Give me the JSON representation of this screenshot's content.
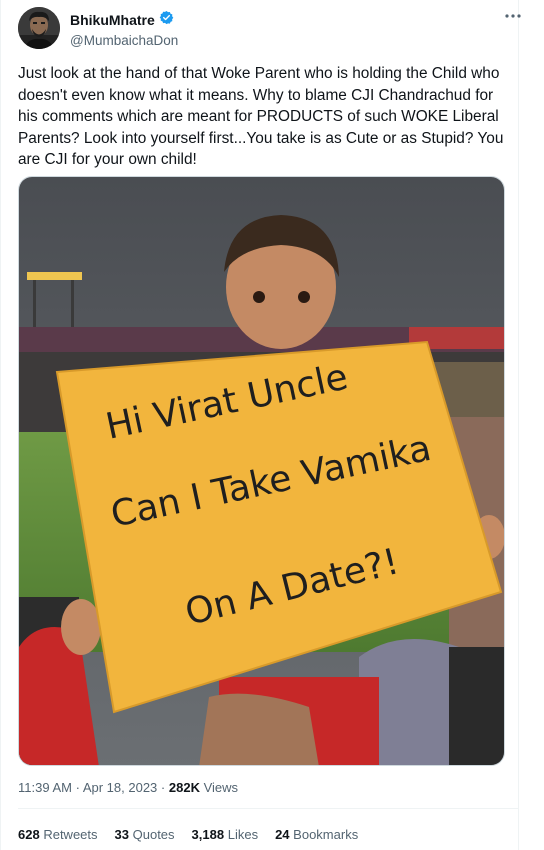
{
  "author": {
    "name": "BhikuMhatre",
    "handle": "@MumbaichaDon",
    "verified": true,
    "badge_color": "#1d9bf0"
  },
  "more_icon": "more-horizontal-icon",
  "tweet_text": "Just look at the hand of that Woke Parent who is holding the Child who doesn't even know what it means. Why to blame CJI Chandrachud for his comments which are meant for PRODUCTS of such WOKE Liberal Parents? Look into yourself first...You take is as Cute or as Stupid? You are CJI for your own child!",
  "photo": {
    "sign_lines": [
      "Hi Virat Uncle",
      "Can I Take Vamika",
      "On A Date?!"
    ]
  },
  "meta": {
    "time": "11:39 AM",
    "separator": "·",
    "date": "Apr 18, 2023",
    "views_count": "282K",
    "views_label": "Views"
  },
  "stats": {
    "retweets_count": "628",
    "retweets_label": "Retweets",
    "quotes_count": "33",
    "quotes_label": "Quotes",
    "likes_count": "3,188",
    "likes_label": "Likes",
    "bookmarks_count": "24",
    "bookmarks_label": "Bookmarks"
  }
}
